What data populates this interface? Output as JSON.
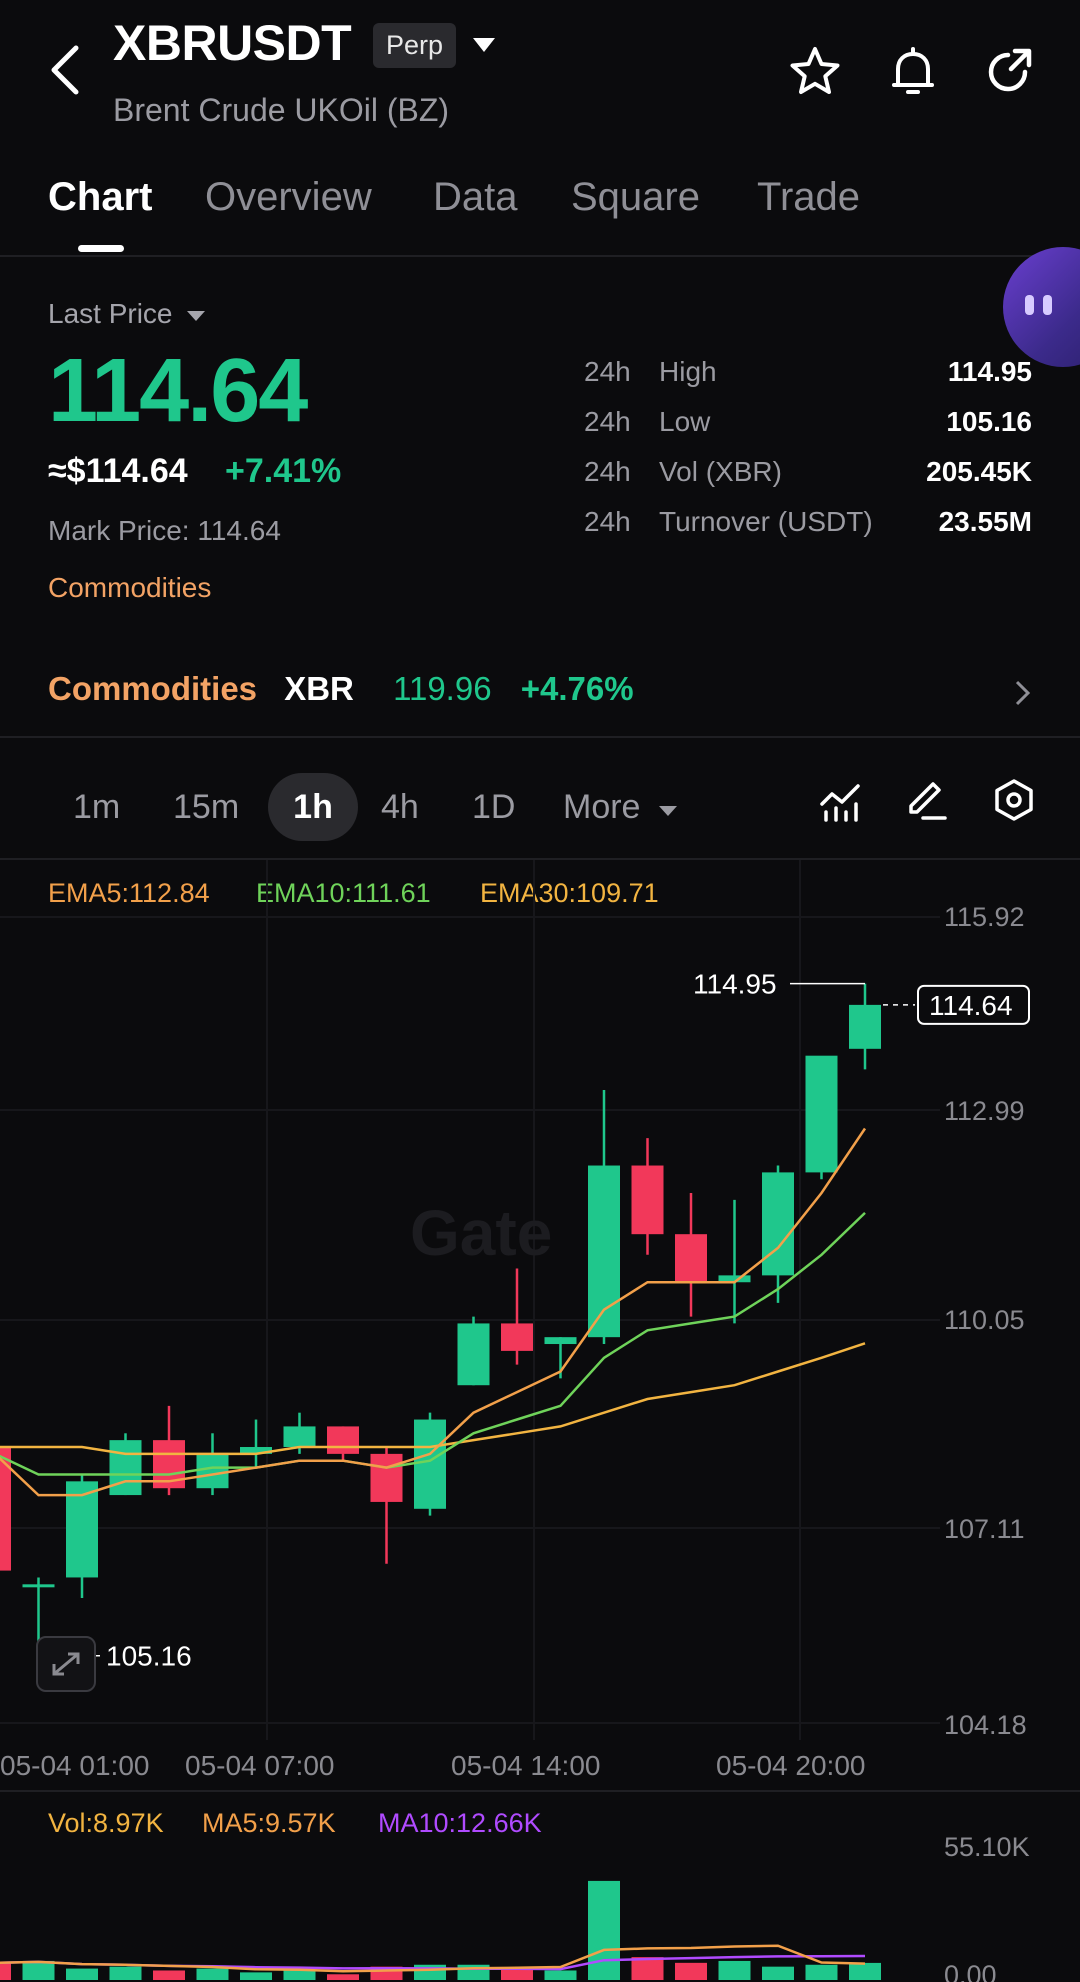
{
  "header": {
    "symbol": "XBRUSDT",
    "badge": "Perp",
    "subtitle": "Brent Crude UKOil (BZ)",
    "icons": [
      "back-icon",
      "star-icon",
      "bell-icon",
      "share-icon"
    ]
  },
  "tabs": [
    "Chart",
    "Overview",
    "Data",
    "Square",
    "Trade"
  ],
  "price_panel": {
    "last_price_label": "Last Price",
    "last_price": "114.64",
    "usd_value": "≈$114.64",
    "change_pct": "+7.41%",
    "mark_price": "Mark Price: 114.64",
    "category": "Commodities",
    "stats": [
      {
        "period": "24h",
        "name": "High",
        "value": "114.95"
      },
      {
        "period": "24h",
        "name": "Low",
        "value": "105.16"
      },
      {
        "period": "24h",
        "name": "Vol (XBR)",
        "value": "205.45K"
      },
      {
        "period": "24h",
        "name": "Turnover (USDT)",
        "value": "23.55M"
      }
    ]
  },
  "related": {
    "category": "Commodities",
    "symbol": "XBR",
    "price": "119.96",
    "change": "+4.76%"
  },
  "timeframes": {
    "options": [
      "1m",
      "15m",
      "1h",
      "4h",
      "1D",
      "More"
    ],
    "selected": "1h"
  },
  "indicators": {
    "ema5": "EMA5:112.84",
    "ema10": "EMA10:111.61",
    "ema30": "EMA30:109.71",
    "vol": "Vol:8.97K",
    "ma5": "MA5:9.57K",
    "ma10": "MA10:12.66K"
  },
  "colors": {
    "up": "#1fc78c",
    "down": "#f2385a",
    "ema5": "#f2a04a",
    "ema10": "#6fd35a",
    "ema30": "#f2b441",
    "ma10": "#b04bff",
    "accent": "#f3a365"
  },
  "chart_data": {
    "type": "candlestick",
    "y_ticks": [
      "115.92",
      "112.99",
      "110.05",
      "107.11",
      "104.18"
    ],
    "ylim": [
      104.18,
      115.92
    ],
    "x_ticks": [
      "05-04 01:00",
      "05-04 07:00",
      "05-04 14:00",
      "05-04 20:00"
    ],
    "high_label": "114.95",
    "low_label": "105.16",
    "last_label": "114.64",
    "candles": [
      {
        "o": 108.2,
        "h": 108.4,
        "l": 106.2,
        "c": 106.4
      },
      {
        "o": 106.2,
        "h": 106.3,
        "l": 105.16,
        "c": 106.2
      },
      {
        "o": 106.3,
        "h": 107.8,
        "l": 106.0,
        "c": 107.7
      },
      {
        "o": 107.5,
        "h": 108.4,
        "l": 107.5,
        "c": 108.3
      },
      {
        "o": 108.3,
        "h": 108.8,
        "l": 107.5,
        "c": 107.6
      },
      {
        "o": 107.6,
        "h": 108.4,
        "l": 107.5,
        "c": 108.1
      },
      {
        "o": 108.1,
        "h": 108.6,
        "l": 107.9,
        "c": 108.2
      },
      {
        "o": 108.2,
        "h": 108.7,
        "l": 108.1,
        "c": 108.5
      },
      {
        "o": 108.5,
        "h": 108.5,
        "l": 108.0,
        "c": 108.1
      },
      {
        "o": 108.1,
        "h": 108.2,
        "l": 106.5,
        "c": 107.4
      },
      {
        "o": 107.3,
        "h": 108.7,
        "l": 107.2,
        "c": 108.6
      },
      {
        "o": 109.1,
        "h": 110.1,
        "l": 109.1,
        "c": 110.0
      },
      {
        "o": 110.0,
        "h": 110.8,
        "l": 109.4,
        "c": 109.6
      },
      {
        "o": 109.7,
        "h": 109.8,
        "l": 109.2,
        "c": 109.8
      },
      {
        "o": 109.8,
        "h": 113.4,
        "l": 109.7,
        "c": 112.3
      },
      {
        "o": 112.3,
        "h": 112.7,
        "l": 111.0,
        "c": 111.3
      },
      {
        "o": 111.3,
        "h": 111.9,
        "l": 110.1,
        "c": 110.6
      },
      {
        "o": 110.6,
        "h": 111.8,
        "l": 110.0,
        "c": 110.7
      },
      {
        "o": 110.7,
        "h": 112.3,
        "l": 110.3,
        "c": 112.2
      },
      {
        "o": 112.2,
        "h": 113.5,
        "l": 112.1,
        "c": 113.9
      },
      {
        "o": 114.0,
        "h": 114.95,
        "l": 113.7,
        "c": 114.64
      }
    ],
    "ema5": [
      108.1,
      107.5,
      107.5,
      107.7,
      107.7,
      107.8,
      107.9,
      108.0,
      108.0,
      107.9,
      108.1,
      108.7,
      109.0,
      109.3,
      110.2,
      110.6,
      110.6,
      110.6,
      111.1,
      111.9,
      112.84
    ],
    "ema10": [
      108.1,
      107.8,
      107.8,
      107.8,
      107.8,
      107.9,
      107.9,
      108.0,
      108.0,
      107.9,
      108.0,
      108.4,
      108.6,
      108.8,
      109.5,
      109.9,
      110.0,
      110.1,
      110.5,
      111.0,
      111.61
    ],
    "ema30": [
      108.2,
      108.2,
      108.2,
      108.1,
      108.1,
      108.1,
      108.1,
      108.2,
      108.2,
      108.2,
      108.2,
      108.3,
      108.4,
      108.5,
      108.7,
      108.9,
      109.0,
      109.1,
      109.3,
      109.5,
      109.71
    ],
    "volume_top_label": "55.10K",
    "volume_bottom_label": "0.00",
    "volume_max": 55.1,
    "volumes": [
      9,
      10,
      6,
      7,
      5,
      6,
      4,
      5,
      3,
      7,
      8,
      8,
      6,
      5,
      52,
      12,
      9,
      10,
      7,
      8,
      8.97
    ]
  }
}
